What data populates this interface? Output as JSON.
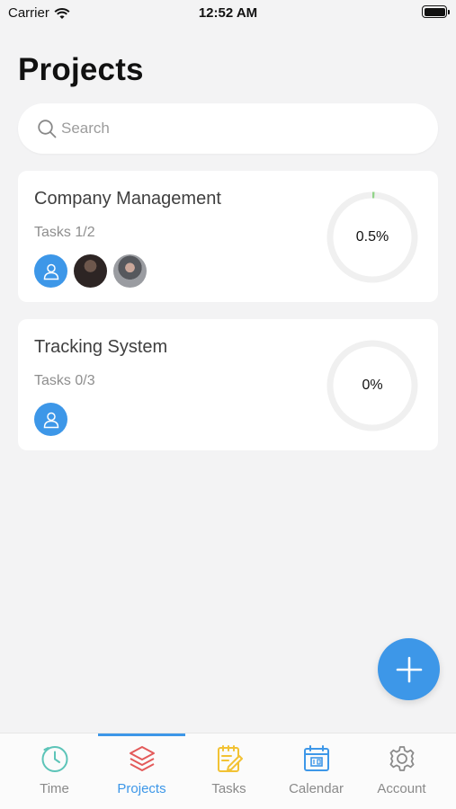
{
  "status_bar": {
    "carrier": "Carrier",
    "time": "12:52 AM"
  },
  "page": {
    "title": "Projects"
  },
  "search": {
    "placeholder": "Search"
  },
  "projects": [
    {
      "name": "Company Management",
      "tasks": "Tasks 1/2",
      "progress_label": "0.5%",
      "progress_fraction": 0.005,
      "members": [
        "default",
        "photo",
        "photo"
      ]
    },
    {
      "name": "Tracking System",
      "tasks": "Tasks 0/3",
      "progress_label": "0%",
      "progress_fraction": 0,
      "members": [
        "default"
      ]
    }
  ],
  "tabs": [
    {
      "label": "Time",
      "icon": "clock-icon",
      "active": false
    },
    {
      "label": "Projects",
      "icon": "layers-icon",
      "active": true
    },
    {
      "label": "Tasks",
      "icon": "notepad-icon",
      "active": false
    },
    {
      "label": "Calendar",
      "icon": "calendar-icon",
      "active": false
    },
    {
      "label": "Account",
      "icon": "gear-icon",
      "active": false
    }
  ],
  "colors": {
    "accent": "#3d97e8",
    "progress": "#92d48a",
    "ring": "#f0f0f0"
  }
}
